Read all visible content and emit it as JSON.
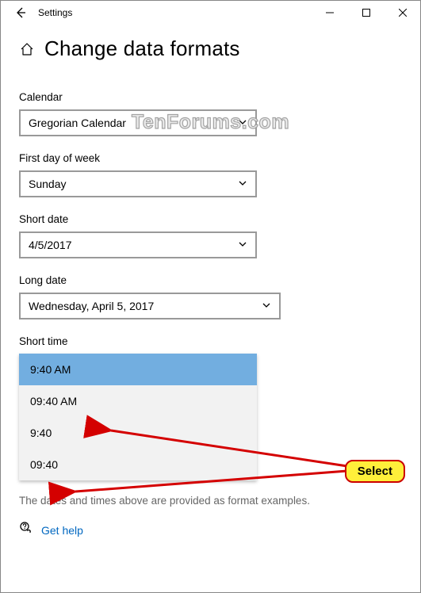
{
  "titlebar": {
    "app_title": "Settings"
  },
  "header": {
    "page_title": "Change data formats"
  },
  "fields": {
    "calendar": {
      "label": "Calendar",
      "value": "Gregorian Calendar"
    },
    "first_day": {
      "label": "First day of week",
      "value": "Sunday"
    },
    "short_date": {
      "label": "Short date",
      "value": "4/5/2017"
    },
    "long_date": {
      "label": "Long date",
      "value": "Wednesday, April 5, 2017"
    },
    "short_time": {
      "label": "Short time",
      "options": [
        "9:40 AM",
        "09:40 AM",
        "9:40",
        "09:40"
      ],
      "selected_index": 0
    }
  },
  "footer_note": "The dates and times above are provided as format examples.",
  "help_link": "Get help",
  "watermark": "TenForums.com",
  "annotation": {
    "label": "Select"
  }
}
